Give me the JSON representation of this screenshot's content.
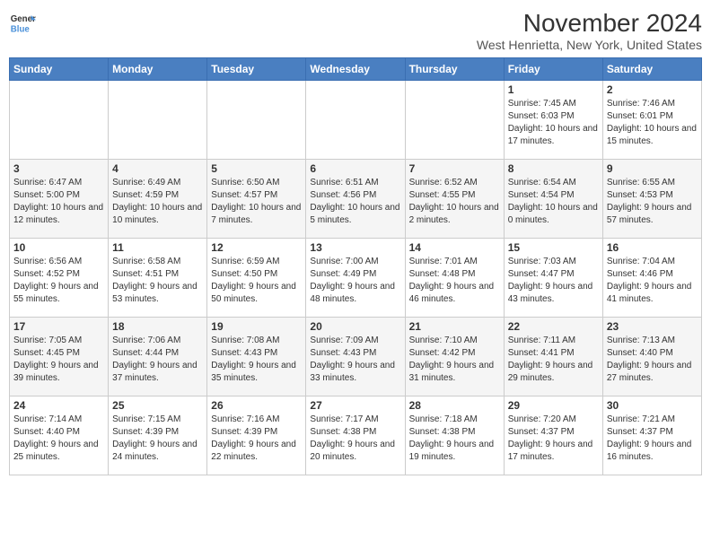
{
  "header": {
    "logo_line1": "General",
    "logo_line2": "Blue",
    "month": "November 2024",
    "location": "West Henrietta, New York, United States"
  },
  "days_of_week": [
    "Sunday",
    "Monday",
    "Tuesday",
    "Wednesday",
    "Thursday",
    "Friday",
    "Saturday"
  ],
  "weeks": [
    [
      {
        "day": "",
        "text": ""
      },
      {
        "day": "",
        "text": ""
      },
      {
        "day": "",
        "text": ""
      },
      {
        "day": "",
        "text": ""
      },
      {
        "day": "",
        "text": ""
      },
      {
        "day": "1",
        "text": "Sunrise: 7:45 AM\nSunset: 6:03 PM\nDaylight: 10 hours and 17 minutes."
      },
      {
        "day": "2",
        "text": "Sunrise: 7:46 AM\nSunset: 6:01 PM\nDaylight: 10 hours and 15 minutes."
      }
    ],
    [
      {
        "day": "3",
        "text": "Sunrise: 6:47 AM\nSunset: 5:00 PM\nDaylight: 10 hours and 12 minutes."
      },
      {
        "day": "4",
        "text": "Sunrise: 6:49 AM\nSunset: 4:59 PM\nDaylight: 10 hours and 10 minutes."
      },
      {
        "day": "5",
        "text": "Sunrise: 6:50 AM\nSunset: 4:57 PM\nDaylight: 10 hours and 7 minutes."
      },
      {
        "day": "6",
        "text": "Sunrise: 6:51 AM\nSunset: 4:56 PM\nDaylight: 10 hours and 5 minutes."
      },
      {
        "day": "7",
        "text": "Sunrise: 6:52 AM\nSunset: 4:55 PM\nDaylight: 10 hours and 2 minutes."
      },
      {
        "day": "8",
        "text": "Sunrise: 6:54 AM\nSunset: 4:54 PM\nDaylight: 10 hours and 0 minutes."
      },
      {
        "day": "9",
        "text": "Sunrise: 6:55 AM\nSunset: 4:53 PM\nDaylight: 9 hours and 57 minutes."
      }
    ],
    [
      {
        "day": "10",
        "text": "Sunrise: 6:56 AM\nSunset: 4:52 PM\nDaylight: 9 hours and 55 minutes."
      },
      {
        "day": "11",
        "text": "Sunrise: 6:58 AM\nSunset: 4:51 PM\nDaylight: 9 hours and 53 minutes."
      },
      {
        "day": "12",
        "text": "Sunrise: 6:59 AM\nSunset: 4:50 PM\nDaylight: 9 hours and 50 minutes."
      },
      {
        "day": "13",
        "text": "Sunrise: 7:00 AM\nSunset: 4:49 PM\nDaylight: 9 hours and 48 minutes."
      },
      {
        "day": "14",
        "text": "Sunrise: 7:01 AM\nSunset: 4:48 PM\nDaylight: 9 hours and 46 minutes."
      },
      {
        "day": "15",
        "text": "Sunrise: 7:03 AM\nSunset: 4:47 PM\nDaylight: 9 hours and 43 minutes."
      },
      {
        "day": "16",
        "text": "Sunrise: 7:04 AM\nSunset: 4:46 PM\nDaylight: 9 hours and 41 minutes."
      }
    ],
    [
      {
        "day": "17",
        "text": "Sunrise: 7:05 AM\nSunset: 4:45 PM\nDaylight: 9 hours and 39 minutes."
      },
      {
        "day": "18",
        "text": "Sunrise: 7:06 AM\nSunset: 4:44 PM\nDaylight: 9 hours and 37 minutes."
      },
      {
        "day": "19",
        "text": "Sunrise: 7:08 AM\nSunset: 4:43 PM\nDaylight: 9 hours and 35 minutes."
      },
      {
        "day": "20",
        "text": "Sunrise: 7:09 AM\nSunset: 4:43 PM\nDaylight: 9 hours and 33 minutes."
      },
      {
        "day": "21",
        "text": "Sunrise: 7:10 AM\nSunset: 4:42 PM\nDaylight: 9 hours and 31 minutes."
      },
      {
        "day": "22",
        "text": "Sunrise: 7:11 AM\nSunset: 4:41 PM\nDaylight: 9 hours and 29 minutes."
      },
      {
        "day": "23",
        "text": "Sunrise: 7:13 AM\nSunset: 4:40 PM\nDaylight: 9 hours and 27 minutes."
      }
    ],
    [
      {
        "day": "24",
        "text": "Sunrise: 7:14 AM\nSunset: 4:40 PM\nDaylight: 9 hours and 25 minutes."
      },
      {
        "day": "25",
        "text": "Sunrise: 7:15 AM\nSunset: 4:39 PM\nDaylight: 9 hours and 24 minutes."
      },
      {
        "day": "26",
        "text": "Sunrise: 7:16 AM\nSunset: 4:39 PM\nDaylight: 9 hours and 22 minutes."
      },
      {
        "day": "27",
        "text": "Sunrise: 7:17 AM\nSunset: 4:38 PM\nDaylight: 9 hours and 20 minutes."
      },
      {
        "day": "28",
        "text": "Sunrise: 7:18 AM\nSunset: 4:38 PM\nDaylight: 9 hours and 19 minutes."
      },
      {
        "day": "29",
        "text": "Sunrise: 7:20 AM\nSunset: 4:37 PM\nDaylight: 9 hours and 17 minutes."
      },
      {
        "day": "30",
        "text": "Sunrise: 7:21 AM\nSunset: 4:37 PM\nDaylight: 9 hours and 16 minutes."
      }
    ]
  ]
}
